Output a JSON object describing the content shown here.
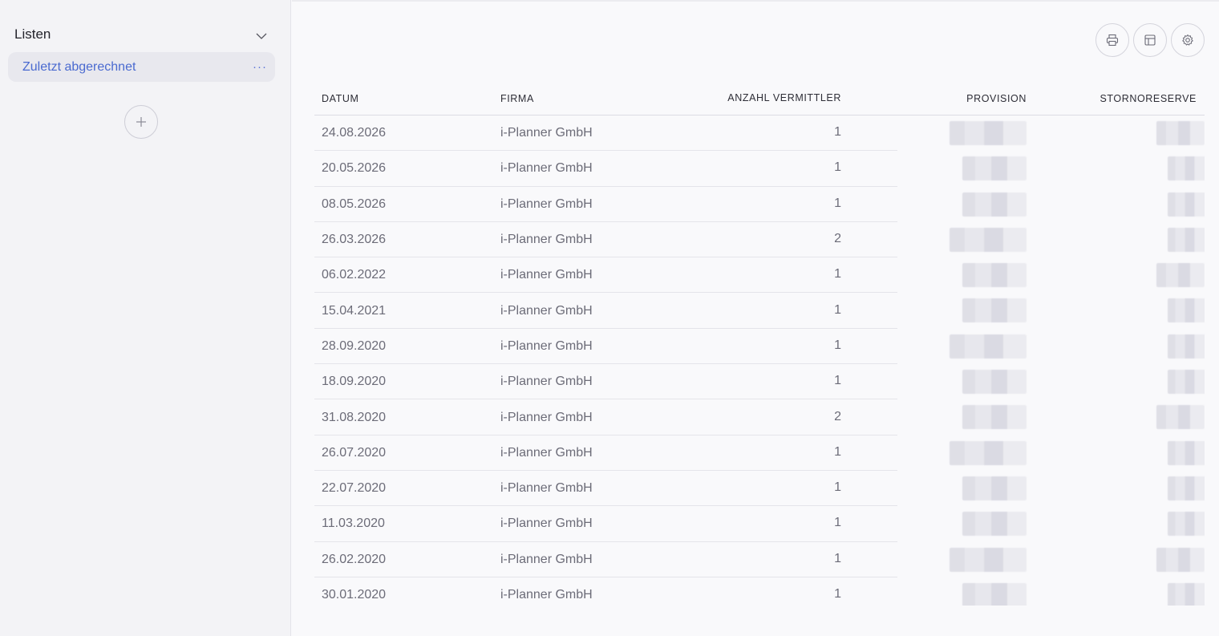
{
  "sidebar": {
    "title": "Listen",
    "items": [
      {
        "label": "Zuletzt abgerechnet"
      }
    ]
  },
  "table": {
    "columns": {
      "datum": "Datum",
      "firma": "Firma",
      "anzahl": "Anzahl Vermittler",
      "provision": "Provision",
      "stornoreserve": "Stornoreserve"
    },
    "rows": [
      {
        "datum": "24.08.2026",
        "firma": "i-Planner GmbH",
        "anzahl": "1"
      },
      {
        "datum": "20.05.2026",
        "firma": "i-Planner GmbH",
        "anzahl": "1"
      },
      {
        "datum": "08.05.2026",
        "firma": "i-Planner GmbH",
        "anzahl": "1"
      },
      {
        "datum": "26.03.2026",
        "firma": "i-Planner GmbH",
        "anzahl": "2"
      },
      {
        "datum": "06.02.2022",
        "firma": "i-Planner GmbH",
        "anzahl": "1"
      },
      {
        "datum": "15.04.2021",
        "firma": "i-Planner GmbH",
        "anzahl": "1"
      },
      {
        "datum": "28.09.2020",
        "firma": "i-Planner GmbH",
        "anzahl": "1"
      },
      {
        "datum": "18.09.2020",
        "firma": "i-Planner GmbH",
        "anzahl": "1"
      },
      {
        "datum": "31.08.2020",
        "firma": "i-Planner GmbH",
        "anzahl": "2"
      },
      {
        "datum": "26.07.2020",
        "firma": "i-Planner GmbH",
        "anzahl": "1"
      },
      {
        "datum": "22.07.2020",
        "firma": "i-Planner GmbH",
        "anzahl": "1"
      },
      {
        "datum": "11.03.2020",
        "firma": "i-Planner GmbH",
        "anzahl": "1"
      },
      {
        "datum": "26.02.2020",
        "firma": "i-Planner GmbH",
        "anzahl": "1"
      },
      {
        "datum": "30.01.2020",
        "firma": "i-Planner GmbH",
        "anzahl": "1"
      }
    ]
  },
  "icons": {
    "toolbar": [
      "printer-icon",
      "layout-icon",
      "gear-icon"
    ],
    "sidebar": [
      "chevron-down-icon",
      "more-dots-icon",
      "plus-icon"
    ]
  },
  "colors": {
    "accent": "#4a6ad0",
    "sidebar_bg": "#f3f3f6",
    "main_bg": "#f9f9fb"
  }
}
